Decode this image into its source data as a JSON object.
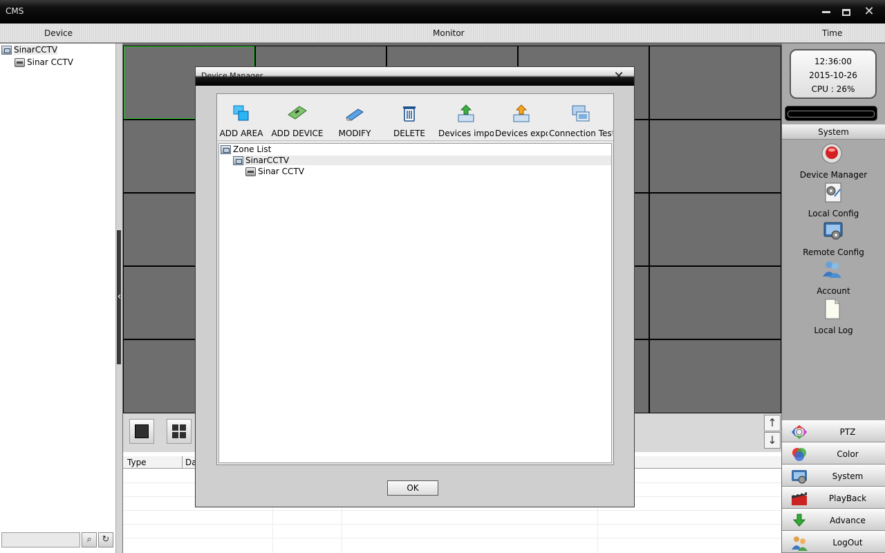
{
  "window": {
    "title": "CMS"
  },
  "header": {
    "device": "Device",
    "monitor": "Monitor",
    "time": "Time"
  },
  "device_tree": {
    "root": "SinarCCTV",
    "child": "Sinar CCTV"
  },
  "log_table": {
    "columns": [
      "Type",
      "Da"
    ]
  },
  "status": {
    "time": "12:36:00",
    "date": "2015-10-26",
    "cpu": "CPU : 26%"
  },
  "system_panel": {
    "header": "System",
    "items": [
      {
        "label": "Device Manager",
        "icon": "device-manager-icon"
      },
      {
        "label": "Local Config",
        "icon": "local-config-icon"
      },
      {
        "label": "Remote Config",
        "icon": "remote-config-icon"
      },
      {
        "label": "Account",
        "icon": "account-icon"
      },
      {
        "label": "Local Log",
        "icon": "local-log-icon"
      }
    ]
  },
  "menu": [
    {
      "label": "PTZ",
      "icon": "ptz-icon"
    },
    {
      "label": "Color",
      "icon": "color-icon"
    },
    {
      "label": "System",
      "icon": "system-icon"
    },
    {
      "label": "PlayBack",
      "icon": "playback-icon"
    },
    {
      "label": "Advance",
      "icon": "advance-icon"
    },
    {
      "label": "LogOut",
      "icon": "logout-icon"
    }
  ],
  "dialog": {
    "title": "Device Manager",
    "toolbar": [
      {
        "label": "ADD AREA",
        "icon": "add-area-icon"
      },
      {
        "label": "ADD DEVICE",
        "icon": "add-device-icon"
      },
      {
        "label": "MODIFY",
        "icon": "modify-icon"
      },
      {
        "label": "DELETE",
        "icon": "trash-icon"
      },
      {
        "label": "Devices import",
        "icon": "import-icon"
      },
      {
        "label": "Devices export",
        "icon": "export-icon"
      },
      {
        "label": "Connection  Test",
        "icon": "connection-test-icon"
      }
    ],
    "tree": {
      "root": "Zone List",
      "area": "SinarCCTV",
      "device": "Sinar CCTV"
    },
    "ok_label": "OK"
  },
  "colors": {
    "titlebar": "#000000",
    "monitor_cell": "#6e6e6e",
    "active_cell_border": "#22cc22",
    "right_panel": "#a9a9a9"
  }
}
